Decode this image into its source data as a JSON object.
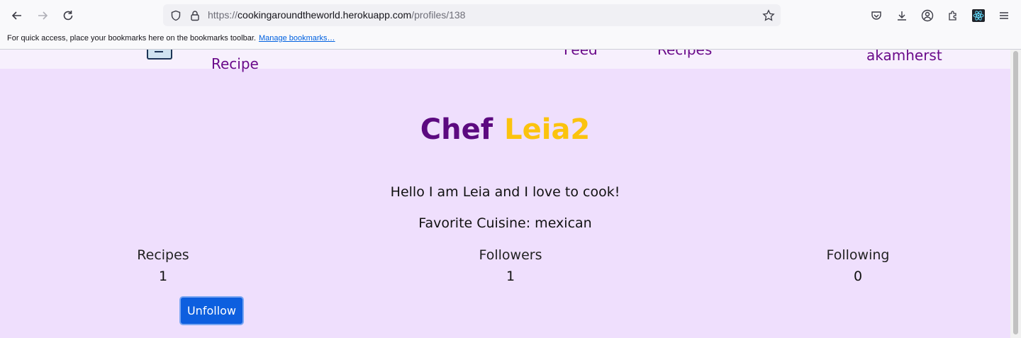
{
  "browser": {
    "url_prefix": "https://",
    "url_host": "cookingaroundtheworld.herokuapp.com",
    "url_path": "/profiles/138",
    "bookmarks_message": "For quick access, place your bookmarks here on the bookmarks toolbar.",
    "bookmarks_link": "Manage bookmarks…"
  },
  "nav": {
    "recipe": "Recipe",
    "feed": "Feed",
    "recipes": "Recipes",
    "user": "akamherst"
  },
  "profile": {
    "title_prefix": "Chef",
    "username": "Leia2",
    "bio": "Hello I am Leia and I love to cook!",
    "favorite_cuisine": "Favorite Cuisine: mexican",
    "stats": {
      "recipes_label": "Recipes",
      "recipes_value": "1",
      "followers_label": "Followers",
      "followers_value": "1",
      "following_label": "Following",
      "following_value": "0"
    },
    "unfollow_label": "Unfollow"
  },
  "colors": {
    "page_bg": "#efdffd",
    "title_chef": "#5c0a80",
    "title_name": "#fbc30e",
    "nav_link": "#6a0a8a",
    "button": "#0d5fdf"
  }
}
